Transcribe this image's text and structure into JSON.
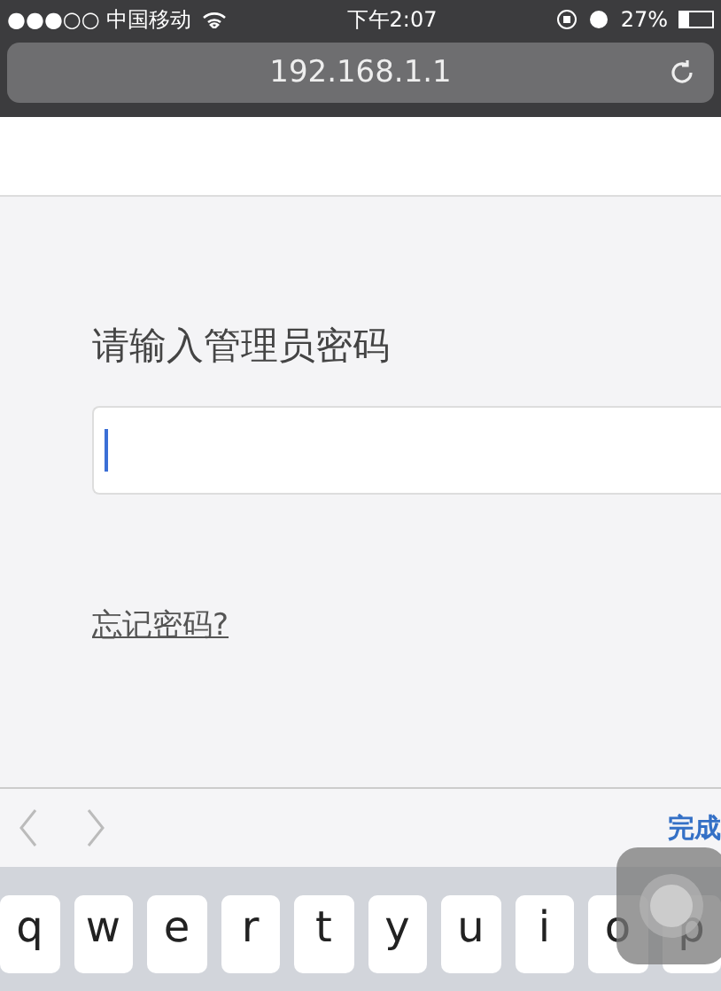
{
  "status_bar": {
    "carrier": "●●●○○ 中国移动",
    "time": "下午2:07",
    "battery": "27%"
  },
  "address_bar": {
    "url": "192.168.1.1"
  },
  "login": {
    "label": "请输入管理员密码",
    "password_field": {
      "focused": true
    },
    "forgot_link": "忘记密码?"
  },
  "keyboard_toolbar": {
    "done": "完成"
  },
  "keyboard": {
    "keys": [
      "q",
      "w",
      "e",
      "r",
      "t",
      "y",
      "u",
      "i",
      "o",
      "p"
    ]
  }
}
